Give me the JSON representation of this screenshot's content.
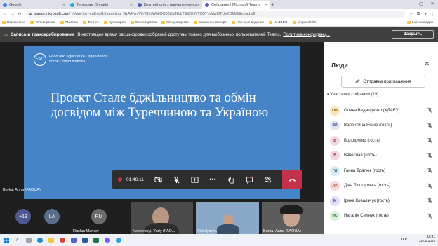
{
  "browser": {
    "tabs": [
      {
        "label": "Google",
        "color": "#4285f4",
        "active": false
      },
      {
        "label": "Телеграм Онлайн",
        "color": "#2aa3dd",
        "active": false
      },
      {
        "label": "Круглий стіл з навчальними з...",
        "color": "#4b5fc5",
        "active": false
      },
      {
        "label": "Собрание | Microsoft Teams",
        "color": "#5b5fc7",
        "active": true
      }
    ],
    "url_host": "teams.microsoft.com",
    "url_rest": "/_#/pre-join-calling/19:meeting_NzA4NmViYjQtNWNjOC00ZmNhLTllN2EtNTQ5YmMwOTUyZDM@thread.v2",
    "bookmarks": [
      "Психология",
      "Телевидение",
      "Массаж",
      "Фитнес",
      "Кулинария",
      "Скотоводство",
      "Птицеводство",
      "Выполнен импорт",
      "Научные издания",
      "НАЗВЕО",
      "Lingva.Skills"
    ],
    "bookmarks_right": "Інші закладки"
  },
  "banner": {
    "bold": "Запись и транскрибирование",
    "text": "В настоящее время расшифровки собраний доступны только для выбранных пользователей Teams.",
    "link": "Политика конфиденц...",
    "close_label": "Закрыть"
  },
  "slide": {
    "org_line1": "Food and Agriculture Organization",
    "org_line2": "of the United Nations",
    "title": "Проєкт Стале бджільництво та обмін досвідом між Туреччиною та Україною",
    "presenter": "Burka, Anna (FAOUA)"
  },
  "controls": {
    "timer": "01:46:11"
  },
  "gallery": {
    "overflow": "+13",
    "avatars": [
      {
        "initials": "LA",
        "name": "",
        "color": "#5a6e8a"
      },
      {
        "initials": "RM",
        "name": "Ruslan Markov",
        "color": "#6b6b6b"
      }
    ],
    "videos": [
      {
        "name": "Nesterenyi, Yuriy (FAO..."
      },
      {
        "name": "Volodymyr..."
      },
      {
        "name": "Burka, Anna (FAOUA)"
      }
    ]
  },
  "people": {
    "title": "Люди",
    "invite_label": "Отправка приглашения",
    "section_label": "Участники собрания (19)",
    "participants": [
      {
        "initials": "ОВ",
        "name": "Олена Ведмеденко (ХДАЕУ) ...",
        "bg": "#f8e5b8",
        "fg": "#8a5a00"
      },
      {
        "initials": "ВЯ",
        "name": "Валентина Ясько (гость)",
        "bg": "#e0e4f5",
        "fg": "#3b4a8c"
      },
      {
        "initials": "В",
        "name": "Володимир (гость)",
        "bg": "#f3d6e4",
        "fg": "#a0325f"
      },
      {
        "initials": "В",
        "name": "Вячеслав (гость)",
        "bg": "#f3d6e4",
        "fg": "#a0325f"
      },
      {
        "initials": "ГД",
        "name": "Ганна Дралюк (гость)",
        "bg": "#d6ecf3",
        "fg": "#1f6b86"
      },
      {
        "initials": "ДЛ",
        "name": "Діна Лісогурська (гость)",
        "bg": "#f5d9d6",
        "fg": "#a03a2e"
      },
      {
        "initials": "ІК",
        "name": "Ірина Ковальчук (гость)",
        "bg": "#e2dcf5",
        "fg": "#5a3fa8"
      },
      {
        "initials": "НС",
        "name": "Наталія Семчук (гость)",
        "bg": "#dcefdc",
        "fg": "#2e7d32"
      }
    ]
  },
  "taskbar": {
    "lang": "УКР",
    "time": "16:41",
    "date": "31.05.2023"
  }
}
